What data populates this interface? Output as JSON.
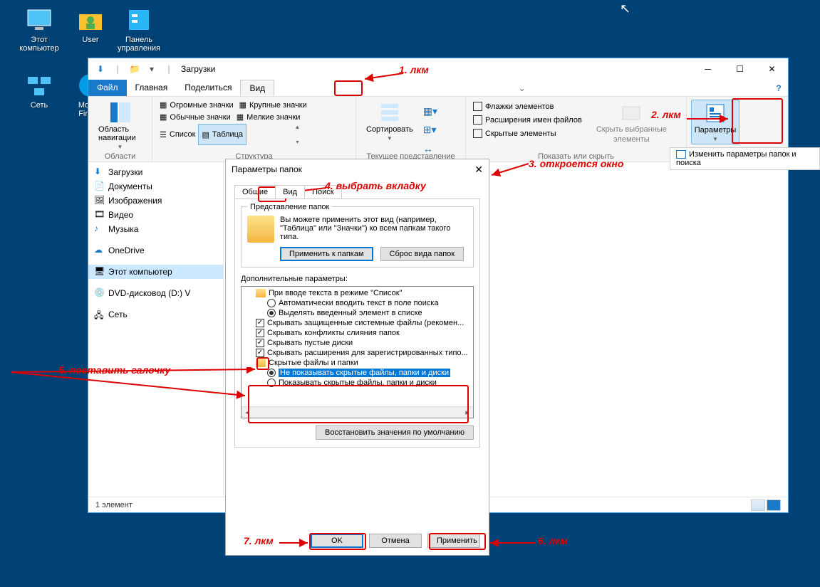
{
  "desktop": {
    "icons": [
      {
        "label": "Этот компьютер"
      },
      {
        "label": "User"
      },
      {
        "label": "Панель управления"
      },
      {
        "label": "Сеть"
      },
      {
        "label": "Mozilla Firefox"
      }
    ]
  },
  "explorer": {
    "title": "Загрузки",
    "menu": {
      "file": "Файл",
      "home": "Главная",
      "share": "Поделиться",
      "view": "Вид"
    },
    "ribbon": {
      "nav_pane": "Область навигации",
      "group_panes": "Области",
      "layout": {
        "huge": "Огромные значки",
        "large": "Крупные значки",
        "medium": "Обычные значки",
        "small": "Мелкие значки",
        "list": "Список",
        "table": "Таблица"
      },
      "group_layout": "Структура",
      "sort": "Сортировать",
      "group_current": "Текущее представление",
      "checks": {
        "item_check": "Флажки элементов",
        "ext": "Расширения имен файлов",
        "hidden": "Скрытые элементы"
      },
      "hide_selected1": "Скрыть выбранные",
      "hide_selected2": "элементы",
      "group_show": "Показать или скрыть",
      "options": "Параметры",
      "tooltip": "Изменить параметры папок и поиска"
    },
    "sidebar": {
      "items": [
        {
          "label": "Загрузки"
        },
        {
          "label": "Документы"
        },
        {
          "label": "Изображения"
        },
        {
          "label": "Видео"
        },
        {
          "label": "Музыка"
        },
        {
          "label": "OneDrive"
        },
        {
          "label": "Этот компьютер"
        },
        {
          "label": "DVD-дисковод (D:) V"
        },
        {
          "label": "Сеть"
        }
      ]
    },
    "status": "1 элемент"
  },
  "dialog": {
    "title": "Параметры папок",
    "tabs": {
      "general": "Общие",
      "view": "Вид",
      "search": "Поиск"
    },
    "folder_views": {
      "legend": "Представление папок",
      "desc": "Вы можете применить этот вид (например, \"Таблица\" или \"Значки\") ко всем папкам такого типа.",
      "apply": "Применить к папкам",
      "reset": "Сброс вида папок"
    },
    "adv_label": "Дополнительные параметры:",
    "tree": [
      {
        "type": "folder",
        "lvl": 1,
        "label": "При вводе текста в режиме \"Список\""
      },
      {
        "type": "radio",
        "lvl": 2,
        "on": false,
        "label": "Автоматически вводить текст в поле поиска"
      },
      {
        "type": "radio",
        "lvl": 2,
        "on": true,
        "label": "Выделять введенный элемент в списке"
      },
      {
        "type": "check",
        "lvl": 1,
        "on": true,
        "label": "Скрывать защищенные системные файлы (рекомен..."
      },
      {
        "type": "check",
        "lvl": 1,
        "on": true,
        "label": "Скрывать конфликты слияния папок"
      },
      {
        "type": "check",
        "lvl": 1,
        "on": true,
        "label": "Скрывать пустые диски"
      },
      {
        "type": "check",
        "lvl": 1,
        "on": true,
        "label": "Скрывать расширения для зарегистрированных типо..."
      },
      {
        "type": "folder",
        "lvl": 1,
        "label": "Скрытые файлы и папки"
      },
      {
        "type": "radio",
        "lvl": 2,
        "on": true,
        "hl": true,
        "label": "Не показывать скрытые файлы, папки и диски"
      },
      {
        "type": "radio",
        "lvl": 2,
        "on": false,
        "label": "Показывать скрытые файлы, папки и диски"
      }
    ],
    "restore": "Восстановить значения по умолчанию",
    "ok": "OK",
    "cancel": "Отмена",
    "apply": "Применить"
  },
  "annotations": {
    "a1": "1. лкм",
    "a2": "2. лкм",
    "a3": "3. откроется окно",
    "a4": "4. выбрать вкладку",
    "a5": "5. поставить галочку",
    "a6": "6. лкм",
    "a7": "7. лкм"
  }
}
